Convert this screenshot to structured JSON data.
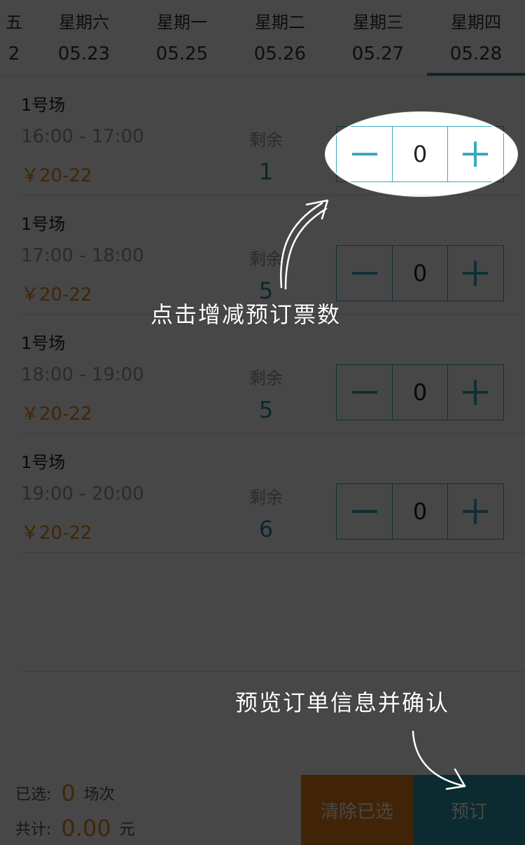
{
  "date_tabs": [
    {
      "weekday": "五",
      "date": "2",
      "active": false
    },
    {
      "weekday": "星期六",
      "date": "05.23",
      "active": false
    },
    {
      "weekday": "星期一",
      "date": "05.25",
      "active": false
    },
    {
      "weekday": "星期二",
      "date": "05.26",
      "active": false
    },
    {
      "weekday": "星期三",
      "date": "05.27",
      "active": false
    },
    {
      "weekday": "星期四",
      "date": "05.28",
      "active": true
    }
  ],
  "remain_label": "剩余",
  "slots": [
    {
      "court": "1号场",
      "time": "16:00 - 17:00",
      "price": "￥20-22",
      "remaining": "1",
      "quantity": "0"
    },
    {
      "court": "1号场",
      "time": "17:00 - 18:00",
      "price": "￥20-22",
      "remaining": "5",
      "quantity": "0"
    },
    {
      "court": "1号场",
      "time": "18:00 - 19:00",
      "price": "￥20-22",
      "remaining": "5",
      "quantity": "0"
    },
    {
      "court": "1号场",
      "time": "19:00 - 20:00",
      "price": "￥20-22",
      "remaining": "6",
      "quantity": "0"
    }
  ],
  "summary": {
    "selected_label": "已选:",
    "selected_count": "0",
    "selected_unit": "场次",
    "total_label": "共计:",
    "total_amount": "0.00",
    "total_unit": "元"
  },
  "actions": {
    "clear_label": "清除已选",
    "book_label": "预订"
  },
  "overlay": {
    "stepper_hint": "点击增减预订票数",
    "book_hint": "预览订单信息并确认"
  },
  "colors": {
    "accent": "#2a9aad",
    "price": "#e68a1e",
    "clear_button": "#e8801c",
    "overlay_dim": "rgba(0,0,0,0.72)"
  }
}
